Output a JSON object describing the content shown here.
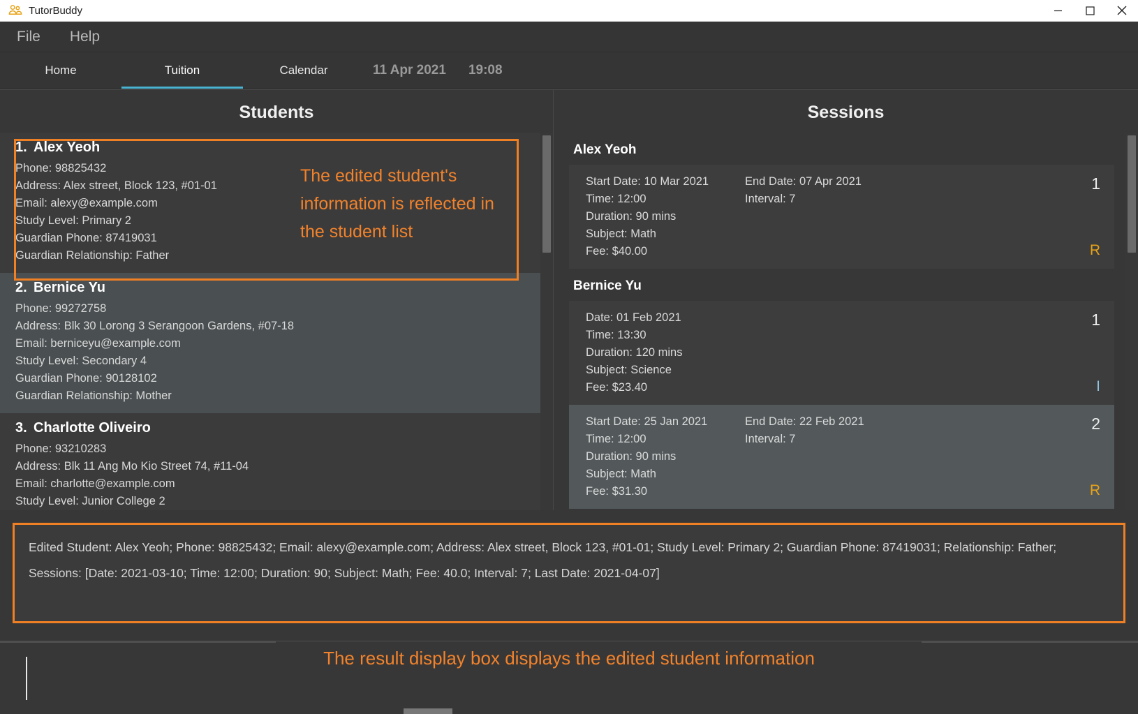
{
  "window": {
    "title": "TutorBuddy",
    "app_icon": "people-group-icon",
    "minimize_label": "Minimize",
    "maximize_label": "Maximize",
    "close_label": "Close"
  },
  "menubar": {
    "items": [
      {
        "label": "File",
        "name": "menu-file"
      },
      {
        "label": "Help",
        "name": "menu-help"
      }
    ]
  },
  "tabs": [
    {
      "label": "Home",
      "active": false
    },
    {
      "label": "Tuition",
      "active": true
    },
    {
      "label": "Calendar",
      "active": false
    }
  ],
  "clock": {
    "date": "11 Apr 2021",
    "time": "19:08"
  },
  "students_panel": {
    "title": "Students",
    "students": [
      {
        "index": "1.",
        "name": "Alex Yeoh",
        "selected": false,
        "lines": [
          "Phone: 98825432",
          "Address: Alex street, Block 123, #01-01",
          "Email: alexy@example.com",
          "Study Level: Primary 2",
          "Guardian Phone: 87419031",
          "Guardian Relationship: Father"
        ]
      },
      {
        "index": "2.",
        "name": "Bernice Yu",
        "selected": true,
        "lines": [
          "Phone: 99272758",
          "Address: Blk 30 Lorong 3 Serangoon Gardens, #07-18",
          "Email: berniceyu@example.com",
          "Study Level: Secondary 4",
          "Guardian Phone: 90128102",
          "Guardian Relationship: Mother"
        ]
      },
      {
        "index": "3.",
        "name": "Charlotte Oliveiro",
        "selected": false,
        "lines": [
          "Phone: 93210283",
          "Address: Blk 11 Ang Mo Kio Street 74, #11-04",
          "Email: charlotte@example.com",
          "Study Level: Junior College 2"
        ]
      }
    ]
  },
  "sessions_panel": {
    "title": "Sessions",
    "groups": [
      {
        "student": "Alex Yeoh",
        "sessions": [
          {
            "selected": false,
            "col_a": [
              "Start Date: 10 Mar 2021",
              "Time: 12:00",
              "Duration: 90 mins",
              "Subject: Math",
              "Fee: $40.00"
            ],
            "col_b": [
              "End Date: 07 Apr 2021",
              "Interval: 7"
            ],
            "count": "1",
            "type_badge": "R",
            "type_kind": "recurring"
          }
        ]
      },
      {
        "student": "Bernice Yu",
        "sessions": [
          {
            "selected": false,
            "col_a": [
              "Date: 01 Feb 2021",
              "Time: 13:30",
              "Duration: 120 mins",
              "Subject: Science",
              "Fee: $23.40"
            ],
            "col_b": [],
            "count": "1",
            "type_badge": "I",
            "type_kind": "individual"
          },
          {
            "selected": true,
            "col_a": [
              "Start Date: 25 Jan 2021",
              "Time: 12:00",
              "Duration: 90 mins",
              "Subject: Math",
              "Fee: $31.30"
            ],
            "col_b": [
              "End Date: 22 Feb 2021",
              "Interval: 7"
            ],
            "count": "2",
            "type_badge": "R",
            "type_kind": "recurring"
          }
        ]
      }
    ]
  },
  "result_box": {
    "text": "Edited Student: Alex Yeoh; Phone: 98825432; Email: alexy@example.com; Address: Alex street, Block 123, #01-01; Study Level: Primary 2; Guardian Phone: 87419031; Relationship: Father; Sessions: [Date: 2021-03-10; Time: 12:00; Duration: 90; Subject: Math; Fee: 40.0; Interval: 7; Last Date: 2021-04-07]"
  },
  "annotations": {
    "student_list_note": "The edited student's information is reflected in the student list",
    "result_box_note": "The result display box displays the edited student information",
    "highlight_color": "#ef8024"
  }
}
